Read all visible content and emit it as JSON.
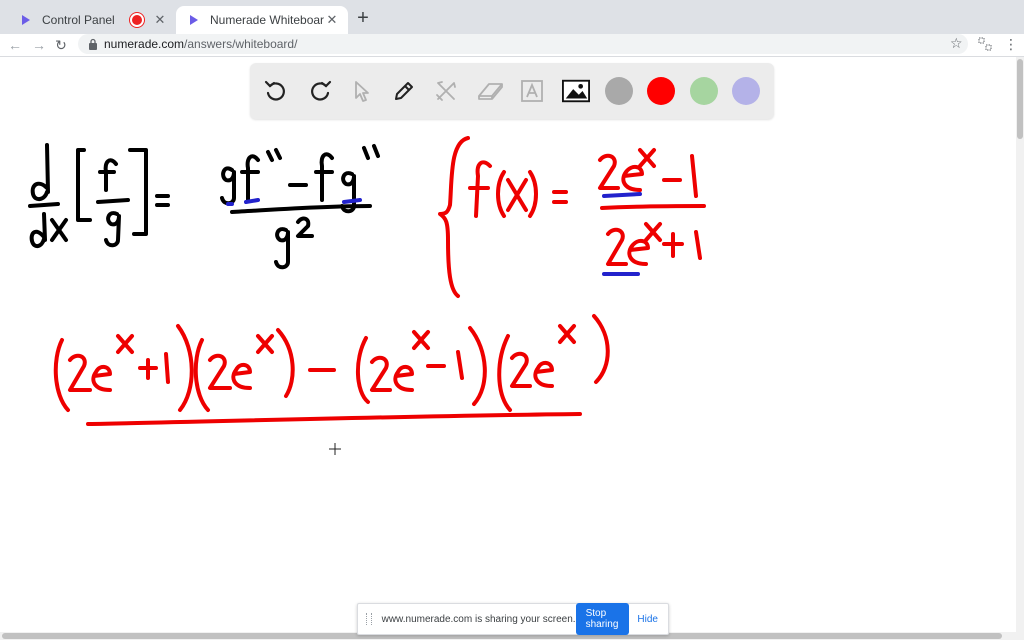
{
  "tabs": [
    {
      "title": "Control Panel",
      "recording": true
    },
    {
      "title": "Numerade Whiteboard",
      "active": true
    }
  ],
  "address": {
    "host": "numerade.com",
    "path": "/answers/whiteboard/"
  },
  "whiteboard": {
    "tools": [
      "undo-icon",
      "redo-icon",
      "pointer-icon",
      "pen-icon",
      "tools-icon",
      "eraser-icon",
      "text-icon",
      "image-icon"
    ],
    "colors": [
      "#a9a9a9",
      "#ff0000",
      "#a6d5a0",
      "#b4b2e8"
    ]
  },
  "sharebar": {
    "message": "www.numerade.com is sharing your screen.",
    "stop_label": "Stop sharing",
    "hide_label": "Hide"
  }
}
